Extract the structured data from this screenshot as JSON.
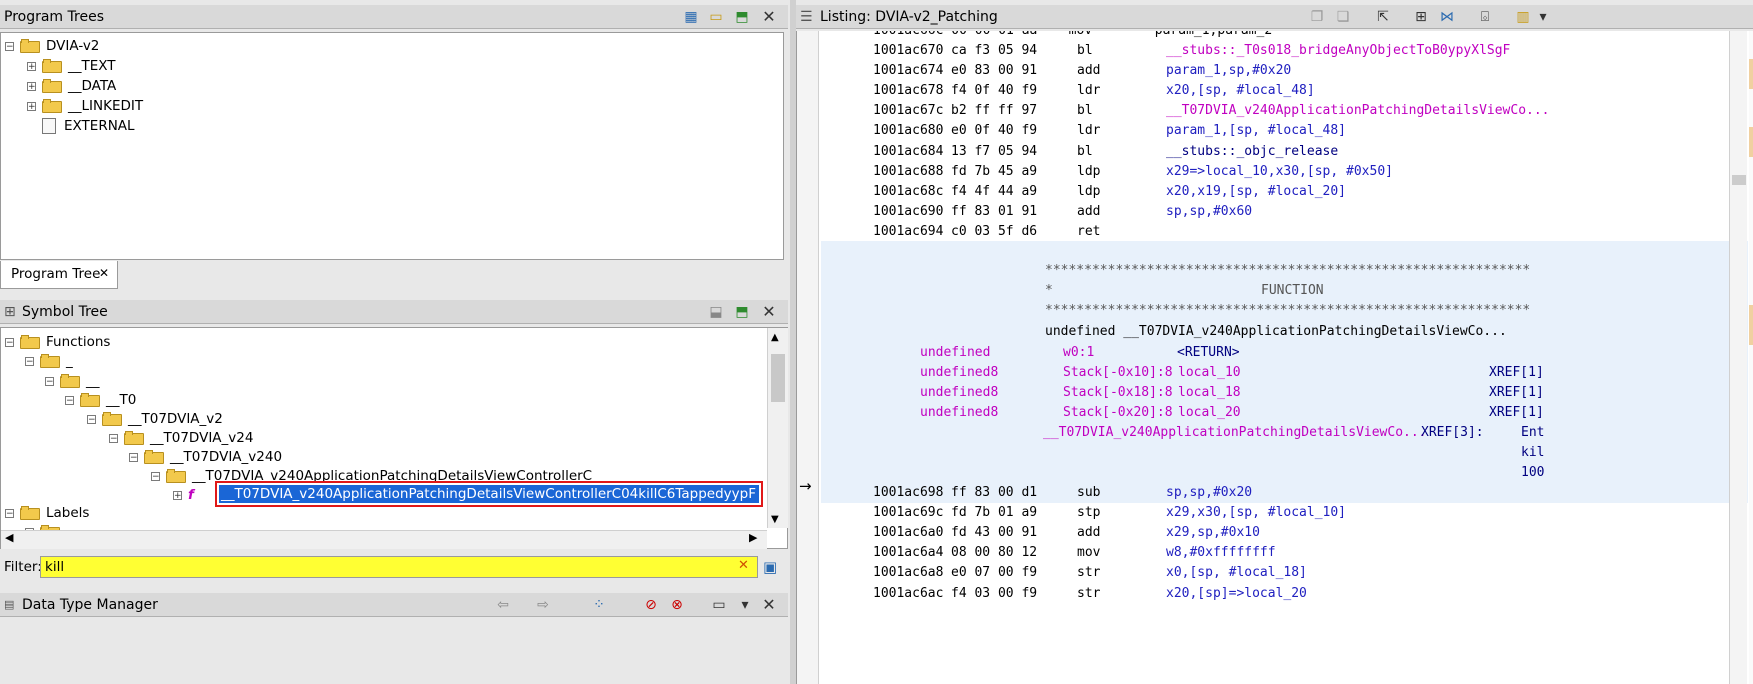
{
  "program_trees": {
    "title": "Program Trees",
    "root": "DVIA-v2",
    "children": [
      "__TEXT",
      "__DATA",
      "__LINKEDIT",
      "EXTERNAL"
    ],
    "tab_label": "Program Tree"
  },
  "symbol_tree": {
    "title": "Symbol Tree",
    "functions_label": "Functions",
    "nodes": [
      "_",
      "__",
      "__T0",
      "__T07DVIA_v2",
      "__T07DVIA_v24",
      "__T07DVIA_v240",
      "__T07DVIA_v240ApplicationPatchingDetailsViewControllerC"
    ],
    "selected": "__T07DVIA_v240ApplicationPatchingDetailsViewControllerC04killC6TappedyypF",
    "labels_label": "Labels",
    "filter_label": "Filter:",
    "filter_value": "kill"
  },
  "data_type_manager": {
    "title": "Data Type Manager"
  },
  "listing": {
    "title": "Listing:  DVIA-v2_Patching",
    "rows_top": [
      {
        "addr": "1001ac670",
        "bytes": "ca f3 05 94",
        "mn": "bl",
        "ops": "__stubs::_T0s018_bridgeAnyObjectToB0ypyXlSgF",
        "kind": "mag"
      },
      {
        "addr": "1001ac674",
        "bytes": "e0 83 00 91",
        "mn": "add",
        "ops": "param_1,sp,#0x20",
        "kind": "opr"
      },
      {
        "addr": "1001ac678",
        "bytes": "f4 0f 40 f9",
        "mn": "ldr",
        "ops": "x20,[sp, #local_48]",
        "kind": "opr"
      },
      {
        "addr": "1001ac67c",
        "bytes": "b2 ff ff 97",
        "mn": "bl",
        "ops": "__T07DVIA_v240ApplicationPatchingDetailsViewCo...",
        "kind": "mag"
      },
      {
        "addr": "1001ac680",
        "bytes": "e0 0f 40 f9",
        "mn": "ldr",
        "ops": "param_1,[sp, #local_48]",
        "kind": "opr"
      },
      {
        "addr": "1001ac684",
        "bytes": "13 f7 05 94",
        "mn": "bl",
        "ops": "__stubs::_objc_release",
        "kind": "navy"
      },
      {
        "addr": "1001ac688",
        "bytes": "fd 7b 45 a9",
        "mn": "ldp",
        "ops": "x29=>local_10,x30,[sp, #0x50]",
        "kind": "opr"
      },
      {
        "addr": "1001ac68c",
        "bytes": "f4 4f 44 a9",
        "mn": "ldp",
        "ops": "x20,x19,[sp, #local_20]",
        "kind": "opr"
      },
      {
        "addr": "1001ac690",
        "bytes": "ff 83 01 91",
        "mn": "add",
        "ops": "sp,sp,#0x60",
        "kind": "opr"
      },
      {
        "addr": "1001ac694",
        "bytes": "c0 03 5f d6",
        "mn": "ret",
        "ops": "",
        "kind": "opr"
      }
    ],
    "function_header": {
      "stars": "**************************************************************",
      "label": "FUNCTION",
      "signature": "undefined __T07DVIA_v240ApplicationPatchingDetailsViewCo...",
      "params": [
        {
          "type": "undefined",
          "loc": "w0:1",
          "name": "<RETURN>",
          "xref": ""
        },
        {
          "type": "undefined8",
          "loc": "Stack[-0x10]:8",
          "name": "local_10",
          "xref": "XREF[1]"
        },
        {
          "type": "undefined8",
          "loc": "Stack[-0x18]:8",
          "name": "local_18",
          "xref": "XREF[1]"
        },
        {
          "type": "undefined8",
          "loc": "Stack[-0x20]:8",
          "name": "local_20",
          "xref": "XREF[1]"
        }
      ],
      "label_line": "__T07DVIA_v240ApplicationPatchingDetailsViewCo...",
      "label_xref": "XREF[3]:",
      "xref_col": [
        "Ent",
        "kil",
        "100"
      ]
    },
    "rows_bottom": [
      {
        "addr": "1001ac698",
        "bytes": "ff 83 00 d1",
        "mn": "sub",
        "ops": "sp,sp,#0x20",
        "kind": "opr"
      },
      {
        "addr": "1001ac69c",
        "bytes": "fd 7b 01 a9",
        "mn": "stp",
        "ops": "x29,x30,[sp, #local_10]",
        "kind": "opr"
      },
      {
        "addr": "1001ac6a0",
        "bytes": "fd 43 00 91",
        "mn": "add",
        "ops": "x29,sp,#0x10",
        "kind": "opr"
      },
      {
        "addr": "1001ac6a4",
        "bytes": "08 00 80 12",
        "mn": "mov",
        "ops": "w8,#0xffffffff",
        "kind": "opr"
      },
      {
        "addr": "1001ac6a8",
        "bytes": "e0 07 00 f9",
        "mn": "str",
        "ops": "x0,[sp, #local_18]",
        "kind": "opr"
      },
      {
        "addr": "1001ac6ac",
        "bytes": "f4 03 00 f9",
        "mn": "str",
        "ops": "x20,[sp]=>local_20",
        "kind": "opr"
      }
    ]
  }
}
